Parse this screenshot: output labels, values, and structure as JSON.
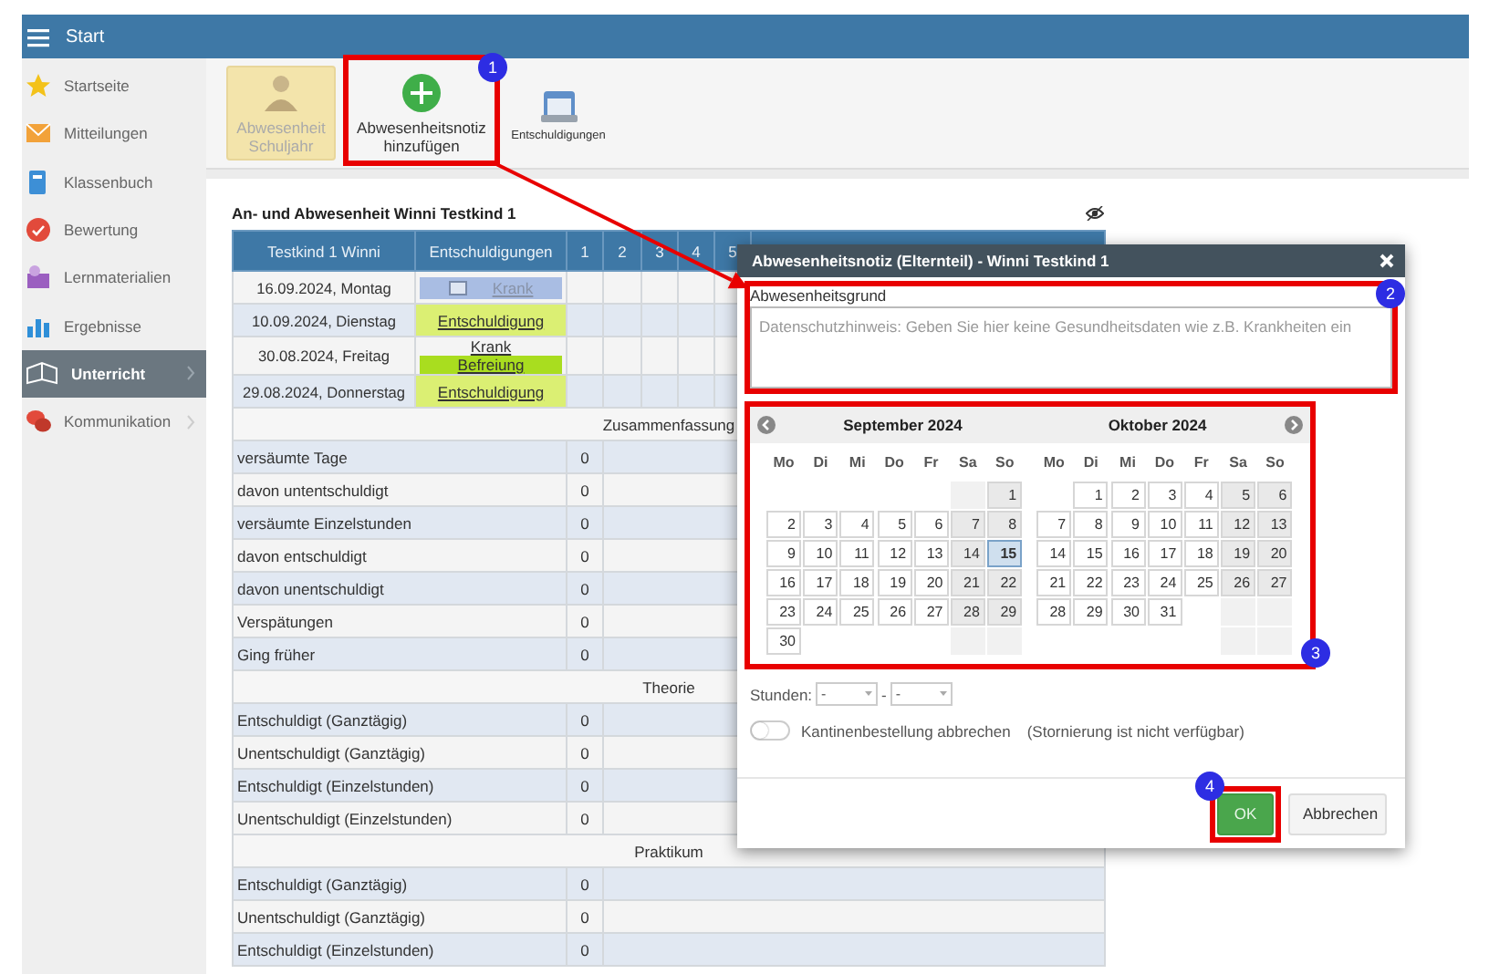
{
  "app_bar": {
    "title": "Start"
  },
  "sidebar": {
    "items": [
      {
        "label": "Startseite",
        "selected": false,
        "has_submenu": false
      },
      {
        "label": "Mitteilungen",
        "selected": false,
        "has_submenu": false
      },
      {
        "label": "Klassenbuch",
        "selected": false,
        "has_submenu": false
      },
      {
        "label": "Bewertung",
        "selected": false,
        "has_submenu": false
      },
      {
        "label": "Lernmaterialien",
        "selected": false,
        "has_submenu": false
      },
      {
        "label": "Ergebnisse",
        "selected": false,
        "has_submenu": false
      },
      {
        "label": "Unterricht",
        "selected": true,
        "has_submenu": true
      },
      {
        "label": "Kommunikation",
        "selected": false,
        "has_submenu": true
      }
    ]
  },
  "toolbar": {
    "buttons": [
      {
        "label": "Abwesenheit Schuljahr",
        "disabled": true,
        "kind": "large"
      },
      {
        "label": "Abwesenheitsnotiz hinzufügen",
        "disabled": false,
        "kind": "large"
      },
      {
        "label": "Entschuldigungen",
        "disabled": false,
        "kind": "small"
      }
    ]
  },
  "attendance": {
    "title": "An- und Abwesenheit Winni Testkind 1",
    "columns": [
      "Testkind 1 Winni",
      "Entschuldigungen",
      "1",
      "2",
      "3",
      "4",
      "5"
    ],
    "rows": [
      {
        "date": "16.09.2024, Montag",
        "excuses": [
          {
            "label": "Krank",
            "kind": "pending"
          }
        ]
      },
      {
        "date": "10.09.2024, Dienstag",
        "excuses": [
          {
            "label": "Entschuldigung",
            "kind": "excuse"
          }
        ]
      },
      {
        "date": "30.08.2024, Freitag",
        "excuses": [
          {
            "label": "Krank",
            "kind": "excuse"
          },
          {
            "label": "Befreiung",
            "kind": "exemption"
          }
        ]
      },
      {
        "date": "29.08.2024, Donnerstag",
        "excuses": [
          {
            "label": "Entschuldigung",
            "kind": "excuse"
          }
        ]
      }
    ],
    "sections": [
      {
        "title": "Zusammenfassung",
        "rows": [
          {
            "label": "versäumte Tage",
            "value": "0"
          },
          {
            "label": "davon untentschuldigt",
            "value": "0"
          },
          {
            "label": "versäumte Einzelstunden",
            "value": "0"
          },
          {
            "label": "davon entschuldigt",
            "value": "0"
          },
          {
            "label": "davon unentschuldigt",
            "value": "0"
          },
          {
            "label": "Verspätungen",
            "value": "0"
          },
          {
            "label": "Ging früher",
            "value": "0"
          }
        ]
      },
      {
        "title": "Theorie",
        "rows": [
          {
            "label": "Entschuldigt (Ganztägig)",
            "value": "0"
          },
          {
            "label": "Unentschuldigt (Ganztägig)",
            "value": "0"
          },
          {
            "label": "Entschuldigt (Einzelstunden)",
            "value": "0"
          },
          {
            "label": "Unentschuldigt (Einzelstunden)",
            "value": "0"
          }
        ]
      },
      {
        "title": "Praktikum",
        "rows": [
          {
            "label": "Entschuldigt (Ganztägig)",
            "value": "0"
          },
          {
            "label": "Unentschuldigt (Ganztägig)",
            "value": "0"
          },
          {
            "label": "Entschuldigt (Einzelstunden)",
            "value": "0"
          }
        ]
      }
    ]
  },
  "dialog": {
    "title": "Abwesenheitsnotiz (Elternteil) - Winni Testkind 1",
    "reason": {
      "label": "Abwesenheitsgrund",
      "placeholder": "Datenschutzhinweis: Geben Sie hier keine Gesundheitsdaten wie z.B. Krankheiten ein"
    },
    "calendar": {
      "months": [
        {
          "title": "September 2024",
          "weekdays": [
            "Mo",
            "Di",
            "Mi",
            "Do",
            "Fr",
            "Sa",
            "So"
          ],
          "weeks": [
            {
              "kind": "first",
              "days": [
                {
                  "day": "1",
                  "selected": false
                }
              ]
            },
            {
              "kind": "full",
              "days": [
                {
                  "day": "2",
                  "selected": false
                },
                {
                  "day": "3",
                  "selected": false
                },
                {
                  "day": "4",
                  "selected": false
                },
                {
                  "day": "5",
                  "selected": false
                },
                {
                  "day": "6",
                  "selected": false
                },
                {
                  "day": "7",
                  "selected": false
                },
                {
                  "day": "8",
                  "selected": false
                }
              ]
            },
            {
              "kind": "full",
              "days": [
                {
                  "day": "9",
                  "selected": false
                },
                {
                  "day": "10",
                  "selected": false
                },
                {
                  "day": "11",
                  "selected": false
                },
                {
                  "day": "12",
                  "selected": false
                },
                {
                  "day": "13",
                  "selected": false
                },
                {
                  "day": "14",
                  "selected": false
                },
                {
                  "day": "15",
                  "selected": true
                }
              ]
            },
            {
              "kind": "full",
              "days": [
                {
                  "day": "16",
                  "selected": false
                },
                {
                  "day": "17",
                  "selected": false
                },
                {
                  "day": "18",
                  "selected": false
                },
                {
                  "day": "19",
                  "selected": false
                },
                {
                  "day": "20",
                  "selected": false
                },
                {
                  "day": "21",
                  "selected": false
                },
                {
                  "day": "22",
                  "selected": false
                }
              ]
            },
            {
              "kind": "full",
              "days": [
                {
                  "day": "23",
                  "selected": false
                },
                {
                  "day": "24",
                  "selected": false
                },
                {
                  "day": "25",
                  "selected": false
                },
                {
                  "day": "26",
                  "selected": false
                },
                {
                  "day": "27",
                  "selected": false
                },
                {
                  "day": "28",
                  "selected": false
                },
                {
                  "day": "29",
                  "selected": false
                }
              ]
            },
            {
              "kind": "last",
              "days": [
                {
                  "day": "30",
                  "selected": false
                }
              ]
            }
          ]
        },
        {
          "title": "Oktober 2024",
          "weekdays": [
            "Mo",
            "Di",
            "Mi",
            "Do",
            "Fr",
            "Sa",
            "So"
          ],
          "weeks": [
            {
              "kind": "first",
              "days": [
                {
                  "day": "1",
                  "selected": false
                },
                {
                  "day": "2",
                  "selected": false
                },
                {
                  "day": "3",
                  "selected": false
                },
                {
                  "day": "4",
                  "selected": false
                },
                {
                  "day": "5",
                  "selected": false
                },
                {
                  "day": "6",
                  "selected": false
                }
              ]
            },
            {
              "kind": "full",
              "days": [
                {
                  "day": "7",
                  "selected": false
                },
                {
                  "day": "8",
                  "selected": false
                },
                {
                  "day": "9",
                  "selected": false
                },
                {
                  "day": "10",
                  "selected": false
                },
                {
                  "day": "11",
                  "selected": false
                },
                {
                  "day": "12",
                  "selected": false
                },
                {
                  "day": "13",
                  "selected": false
                }
              ]
            },
            {
              "kind": "full",
              "days": [
                {
                  "day": "14",
                  "selected": false
                },
                {
                  "day": "15",
                  "selected": false
                },
                {
                  "day": "16",
                  "selected": false
                },
                {
                  "day": "17",
                  "selected": false
                },
                {
                  "day": "18",
                  "selected": false
                },
                {
                  "day": "19",
                  "selected": false
                },
                {
                  "day": "20",
                  "selected": false
                }
              ]
            },
            {
              "kind": "full",
              "days": [
                {
                  "day": "21",
                  "selected": false
                },
                {
                  "day": "22",
                  "selected": false
                },
                {
                  "day": "23",
                  "selected": false
                },
                {
                  "day": "24",
                  "selected": false
                },
                {
                  "day": "25",
                  "selected": false
                },
                {
                  "day": "26",
                  "selected": false
                },
                {
                  "day": "27",
                  "selected": false
                }
              ]
            },
            {
              "kind": "last",
              "days": [
                {
                  "day": "28",
                  "selected": false
                },
                {
                  "day": "29",
                  "selected": false
                },
                {
                  "day": "30",
                  "selected": false
                },
                {
                  "day": "31",
                  "selected": false
                }
              ]
            }
          ]
        }
      ]
    },
    "hours": {
      "label": "Stunden:",
      "from": "-",
      "separator": "-",
      "to": "-"
    },
    "canteen": {
      "label": "Kantinenbestellung abbrechen",
      "note": "(Stornierung ist nicht verfügbar)",
      "on": false
    },
    "buttons": [
      {
        "label": "OK",
        "kind": "primary"
      },
      {
        "label": "Abbrechen",
        "kind": "secondary"
      }
    ]
  },
  "annotations": [
    {
      "number": "1",
      "kind": "inside"
    },
    {
      "number": "2",
      "kind": "inside"
    },
    {
      "number": "3",
      "kind": "bottom"
    },
    {
      "number": "4",
      "kind": "outside"
    }
  ]
}
